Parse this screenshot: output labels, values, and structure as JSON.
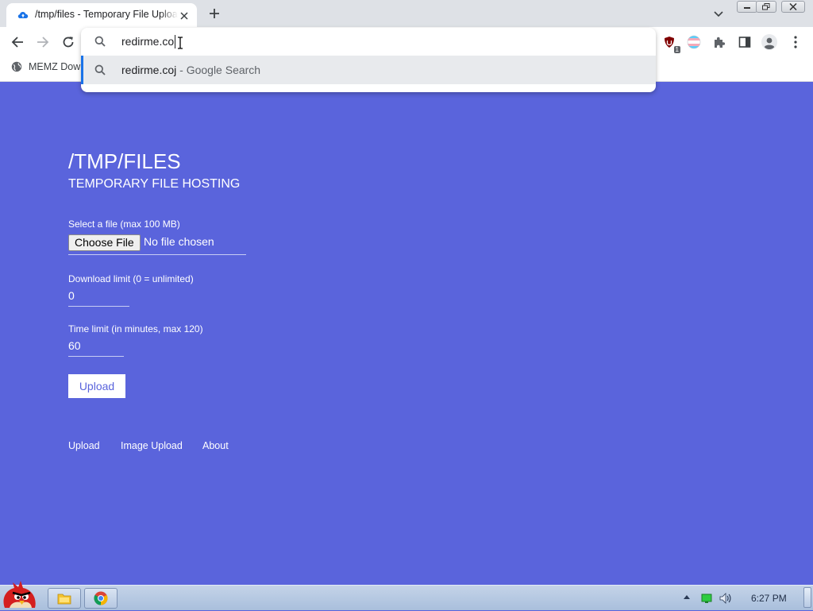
{
  "browser": {
    "tab": {
      "title": "/tmp/files - Temporary File Upload"
    },
    "omnibox": {
      "value": "redirme.co",
      "suggestion": {
        "query": "redirme.coj",
        "separator": " - ",
        "engine": "Google Search"
      }
    },
    "extensions": {
      "shield_badge": "1"
    },
    "bookmarks": [
      {
        "label": "MEMZ Dow"
      }
    ]
  },
  "page": {
    "title": "/TMP/FILES",
    "subtitle": "TEMPORARY FILE HOSTING",
    "form": {
      "file_label": "Select a file (max 100 MB)",
      "choose_file_button": "Choose File",
      "file_status": "No file chosen",
      "download_limit_label": "Download limit (0 = unlimited)",
      "download_limit_value": "0",
      "time_limit_label": "Time limit (in minutes, max 120)",
      "time_limit_value": "60",
      "upload_button": "Upload"
    },
    "footer_links": [
      "Upload",
      "Image Upload",
      "About"
    ]
  },
  "taskbar": {
    "clock": "6:27 PM",
    "buttons": [
      "start-icon",
      "explorer-icon",
      "chrome-icon"
    ]
  },
  "colors": {
    "page_background": "#5a64dc",
    "accent": "#1a73e8",
    "tab_strip": "#dee1e6"
  }
}
